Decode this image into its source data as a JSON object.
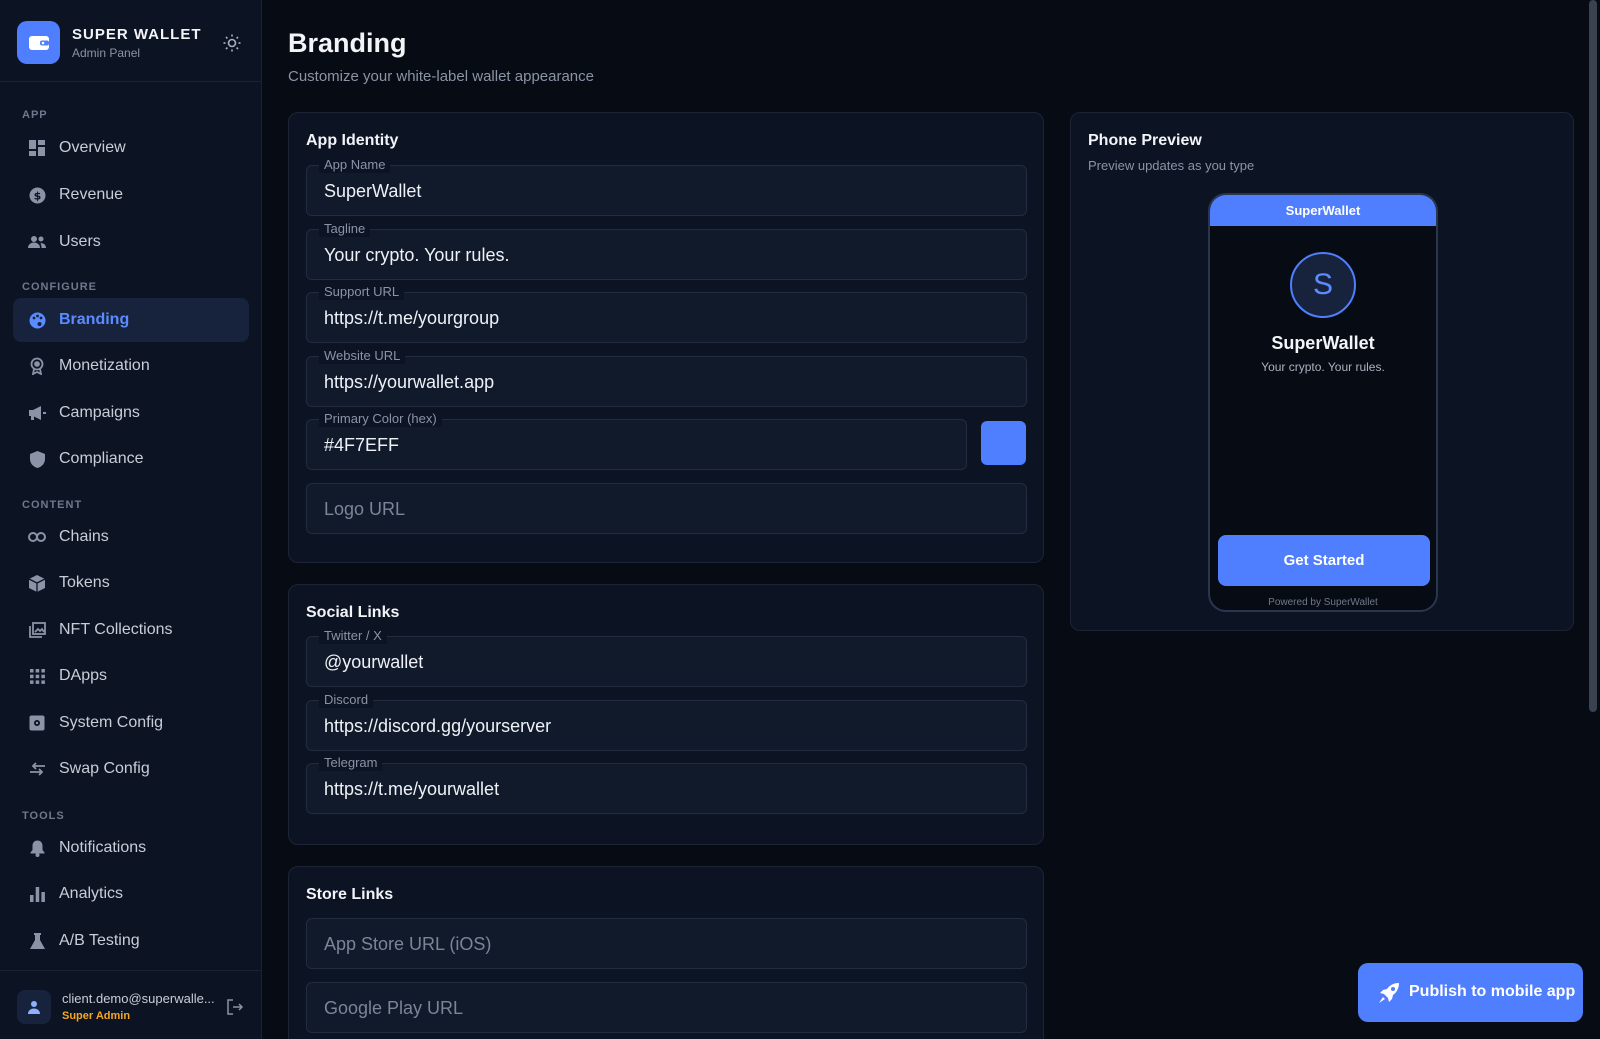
{
  "brand": {
    "title": "SUPER WALLET",
    "subtitle": "Admin Panel",
    "logo_icon": "wallet-icon",
    "theme_icon": "sun-icon"
  },
  "sidebar": {
    "sections": [
      {
        "label": "APP",
        "items": [
          {
            "label": "Overview",
            "icon": "dashboard-icon"
          },
          {
            "label": "Revenue",
            "icon": "dollar-icon"
          },
          {
            "label": "Users",
            "icon": "users-icon"
          }
        ]
      },
      {
        "label": "CONFIGURE",
        "items": [
          {
            "label": "Branding",
            "icon": "palette-icon",
            "active": true
          },
          {
            "label": "Monetization",
            "icon": "award-icon"
          },
          {
            "label": "Campaigns",
            "icon": "megaphone-icon"
          },
          {
            "label": "Compliance",
            "icon": "shield-icon"
          }
        ]
      },
      {
        "label": "CONTENT",
        "items": [
          {
            "label": "Chains",
            "icon": "link-icon"
          },
          {
            "label": "Tokens",
            "icon": "cube-icon"
          },
          {
            "label": "NFT Collections",
            "icon": "images-icon"
          },
          {
            "label": "DApps",
            "icon": "grid-icon"
          },
          {
            "label": "System Config",
            "icon": "settings-icon"
          },
          {
            "label": "Swap Config",
            "icon": "swap-icon"
          }
        ]
      },
      {
        "label": "TOOLS",
        "items": [
          {
            "label": "Notifications",
            "icon": "bell-icon"
          },
          {
            "label": "Analytics",
            "icon": "bar-chart-icon"
          },
          {
            "label": "A/B Testing",
            "icon": "flask-icon"
          }
        ]
      }
    ]
  },
  "user": {
    "email": "client.demo@superwalle...",
    "role": "Super Admin",
    "avatar_icon": "person-icon",
    "logout_icon": "logout-icon"
  },
  "page": {
    "title": "Branding",
    "subtitle": "Customize your white-label wallet appearance"
  },
  "app_identity": {
    "title": "App Identity",
    "app_name": {
      "label": "App Name",
      "value": "SuperWallet"
    },
    "tagline": {
      "label": "Tagline",
      "value": "Your crypto. Your rules."
    },
    "support_url": {
      "label": "Support URL",
      "value": "https://t.me/yourgroup"
    },
    "website_url": {
      "label": "Website URL",
      "value": "https://yourwallet.app"
    },
    "primary_color": {
      "label": "Primary Color (hex)",
      "value": "#4F7EFF"
    },
    "logo_url": {
      "placeholder": "Logo URL"
    }
  },
  "social_links": {
    "title": "Social Links",
    "twitter": {
      "label": "Twitter / X",
      "value": "@yourwallet"
    },
    "discord": {
      "label": "Discord",
      "value": "https://discord.gg/yourserver"
    },
    "telegram": {
      "label": "Telegram",
      "value": "https://t.me/yourwallet"
    }
  },
  "store_links": {
    "title": "Store Links",
    "app_store": {
      "placeholder": "App Store URL (iOS)"
    },
    "google_play": {
      "placeholder": "Google Play URL"
    }
  },
  "phone_preview": {
    "title": "Phone Preview",
    "subtitle": "Preview updates as you type",
    "header": "SuperWallet",
    "avatar_letter": "S",
    "app_name": "SuperWallet",
    "tagline": "Your crypto. Your rules.",
    "cta": "Get Started",
    "powered": "Powered by SuperWallet"
  },
  "publish": {
    "label": "Publish to mobile app",
    "icon": "rocket-icon"
  },
  "colors": {
    "accent": "#4F7EFF",
    "background": "#070B14",
    "sidebar": "#0C1322",
    "role": "#F5A623"
  }
}
